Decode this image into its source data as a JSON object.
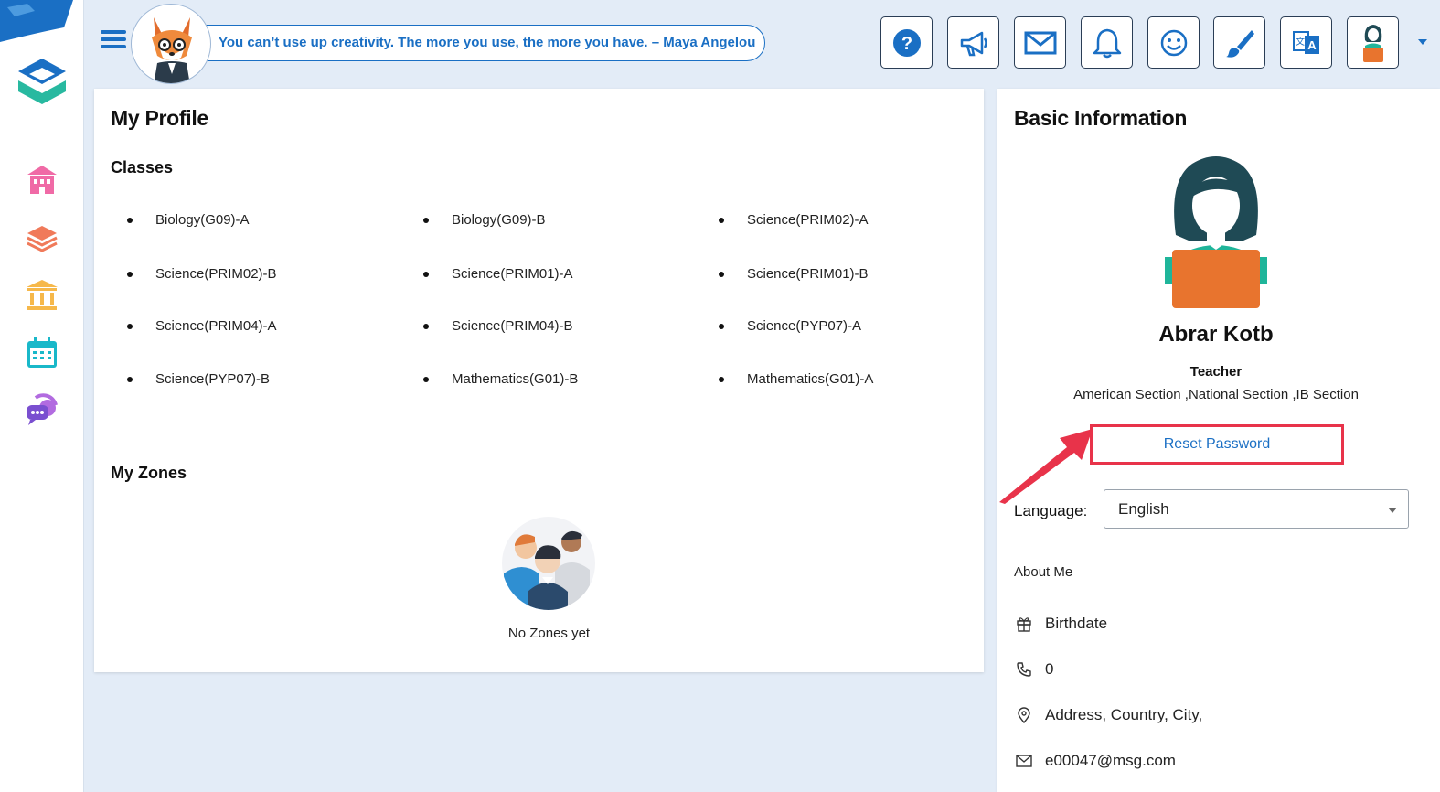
{
  "header": {
    "quote": "You can’t use up creativity. The more you use, the more you have. – Maya Angelou",
    "buttons": [
      {
        "name": "help-icon"
      },
      {
        "name": "megaphone-icon"
      },
      {
        "name": "mail-icon"
      },
      {
        "name": "bell-icon"
      },
      {
        "name": "smiley-icon"
      },
      {
        "name": "paintbrush-icon"
      },
      {
        "name": "translate-icon"
      },
      {
        "name": "user-avatar-icon"
      }
    ]
  },
  "sidebar": {
    "items": [
      {
        "name": "school-icon",
        "color": "#f06aa6"
      },
      {
        "name": "layers-icon",
        "color": "#f07a5a"
      },
      {
        "name": "institution-icon",
        "color": "#f6b84a"
      },
      {
        "name": "calendar-icon",
        "color": "#19b8c9"
      },
      {
        "name": "chat-support-icon",
        "color": "#7a4fd0"
      }
    ]
  },
  "profile": {
    "title": "My Profile",
    "classes_heading": "Classes",
    "classes": [
      "Biology(G09)-A",
      "Biology(G09)-B",
      "Science(PRIM02)-A",
      "Science(PRIM02)-B",
      "Science(PRIM01)-A",
      "Science(PRIM01)-B",
      "Science(PRIM04)-A",
      "Science(PRIM04)-B",
      "Science(PYP07)-A",
      "Science(PYP07)-B",
      "Mathematics(G01)-B",
      "Mathematics(G01)-A"
    ],
    "zones_heading": "My Zones",
    "zones_empty": "No Zones yet"
  },
  "info": {
    "title": "Basic Information",
    "name": "Abrar Kotb",
    "role": "Teacher",
    "sections": "American Section ,National Section ,IB Section",
    "reset_password": "Reset Password",
    "language_label": "Language:",
    "language_value": "English",
    "about_label": "About Me",
    "birthdate": "Birthdate",
    "phone": "0",
    "address": "Address, Country, City,",
    "email": "e00047@msg.com"
  },
  "colors": {
    "accent": "#1a6fc4",
    "highlight": "#e8334a",
    "avatar_laptop": "#e8742e",
    "avatar_hair": "#1f4a55",
    "avatar_shirt": "#1fb59a"
  }
}
